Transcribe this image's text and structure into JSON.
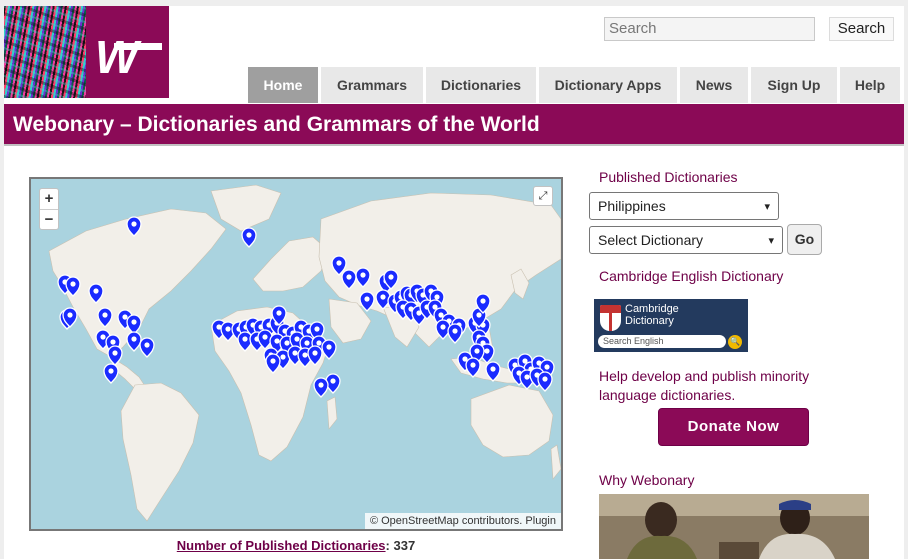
{
  "header": {
    "logo_letter": "W",
    "search_placeholder": "Search",
    "search_button": "Search"
  },
  "nav": {
    "tabs": [
      {
        "label": "Home",
        "active": true
      },
      {
        "label": "Grammars",
        "active": false
      },
      {
        "label": "Dictionaries",
        "active": false
      },
      {
        "label": "Dictionary Apps",
        "active": false
      },
      {
        "label": "News",
        "active": false
      },
      {
        "label": "Sign Up",
        "active": false
      },
      {
        "label": "Help",
        "active": false
      }
    ]
  },
  "banner": {
    "title": "Webonary – Dictionaries and Grammars of the World"
  },
  "map": {
    "zoom_in": "+",
    "zoom_out": "−",
    "attribution": "© OpenStreetMap contributors. Plugin",
    "marker_color": "#1a2bff",
    "land_color": "#f2efe9",
    "water_color": "#aad3df"
  },
  "stats": {
    "published_label": "Number of Published Dictionaries",
    "separator": ":",
    "published_count": "337"
  },
  "sidebar": {
    "published_heading": "Published Dictionaries",
    "country_select": "Philippines",
    "dictionary_select": "Select Dictionary",
    "go_button": "Go",
    "cambridge_heading": "Cambridge English Dictionary",
    "cambridge_name_line1": "Cambridge",
    "cambridge_name_line2": "Dictionary",
    "cambridge_search_placeholder": "Search English",
    "help_text": "Help develop and publish minority language dictionaries.",
    "donate_button": "Donate Now",
    "why_heading": "Why Webonary"
  },
  "colors": {
    "brand": "#8b0a57",
    "heading": "#6e0047",
    "tab_active": "#9f9f9f",
    "tab": "#e8e8e8"
  }
}
